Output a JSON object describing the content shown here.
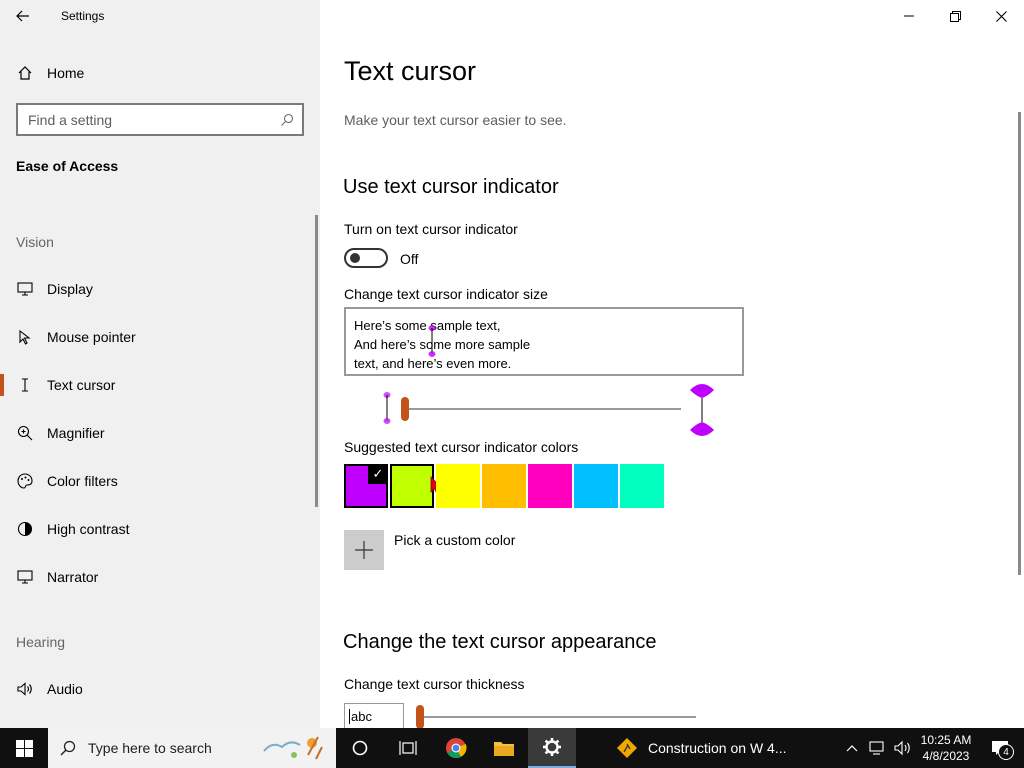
{
  "window": {
    "title": "Settings"
  },
  "sidebar": {
    "home_label": "Home",
    "search_placeholder": "Find a setting",
    "section_title": "Ease of Access",
    "groups": [
      {
        "header": "Vision"
      },
      {
        "header": "Hearing"
      }
    ],
    "items": [
      {
        "label": "Display",
        "icon": "display-icon"
      },
      {
        "label": "Mouse pointer",
        "icon": "mouse-pointer-icon"
      },
      {
        "label": "Text cursor",
        "icon": "text-cursor-icon",
        "active": true
      },
      {
        "label": "Magnifier",
        "icon": "magnifier-icon"
      },
      {
        "label": "Color filters",
        "icon": "color-filters-icon"
      },
      {
        "label": "High contrast",
        "icon": "high-contrast-icon"
      },
      {
        "label": "Narrator",
        "icon": "narrator-icon"
      },
      {
        "label": "Audio",
        "icon": "audio-icon"
      }
    ],
    "active_color": "#c3521b"
  },
  "main": {
    "title": "Text cursor",
    "subtitle": "Make your text cursor easier to see.",
    "indicator_section": {
      "heading": "Use text cursor indicator",
      "toggle_label": "Turn on text cursor indicator",
      "toggle_state": "Off",
      "size_label": "Change text cursor indicator size",
      "preview_lines": [
        "Here’s some sample text,",
        "And here’s some more sample",
        "text, and here’s even more."
      ],
      "colors_label": "Suggested text cursor indicator colors",
      "colors": [
        "#bf00ff",
        "#bfff00",
        "#ffff00",
        "#ffbf00",
        "#ff00bf",
        "#00bfff",
        "#00ffbf"
      ],
      "selected_color": "#bf00ff",
      "custom_color_label": "Pick a custom color"
    },
    "appearance_section": {
      "heading": "Change the text cursor appearance",
      "thickness_label": "Change text cursor thickness",
      "thickness_preview": "abc"
    }
  },
  "taskbar": {
    "search_placeholder": "Type here to search",
    "weather_text": "Construction on W 4...",
    "time": "10:25 AM",
    "date": "4/8/2023",
    "notification_count": "4"
  }
}
